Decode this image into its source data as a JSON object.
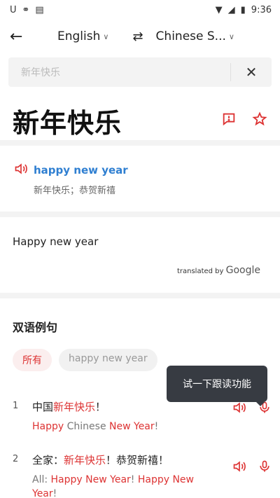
{
  "status": {
    "time": "9:36"
  },
  "topbar": {
    "source_lang": "English",
    "target_lang": "Chinese S..."
  },
  "search": {
    "query": "新年快乐"
  },
  "word": {
    "headword": "新年快乐"
  },
  "dictionary": {
    "english": "happy new year",
    "chinese": "新年快乐；恭贺新禧"
  },
  "translation": {
    "text": "Happy new year",
    "credit_prefix": "translated by",
    "credit_brand": "Google"
  },
  "examples_section": {
    "title": "双语例句",
    "chips": [
      "所有",
      "happy new year"
    ],
    "tooltip": "试一下跟读功能",
    "items": [
      {
        "num": "1",
        "cn_parts": [
          "中国",
          "新年快乐",
          "！"
        ],
        "en_parts": [
          "Happy",
          " Chinese ",
          "New Year",
          "!"
        ]
      },
      {
        "num": "2",
        "cn_parts": [
          "全家：",
          "新年快乐",
          "！恭贺新禧！"
        ],
        "en_parts": [
          "All: ",
          "Happy New Year",
          "! ",
          "Happy New Year",
          "!"
        ]
      }
    ]
  },
  "colors": {
    "accent": "#dd3333",
    "link": "#2f7fd1",
    "tooltip_bg": "#373b42"
  }
}
